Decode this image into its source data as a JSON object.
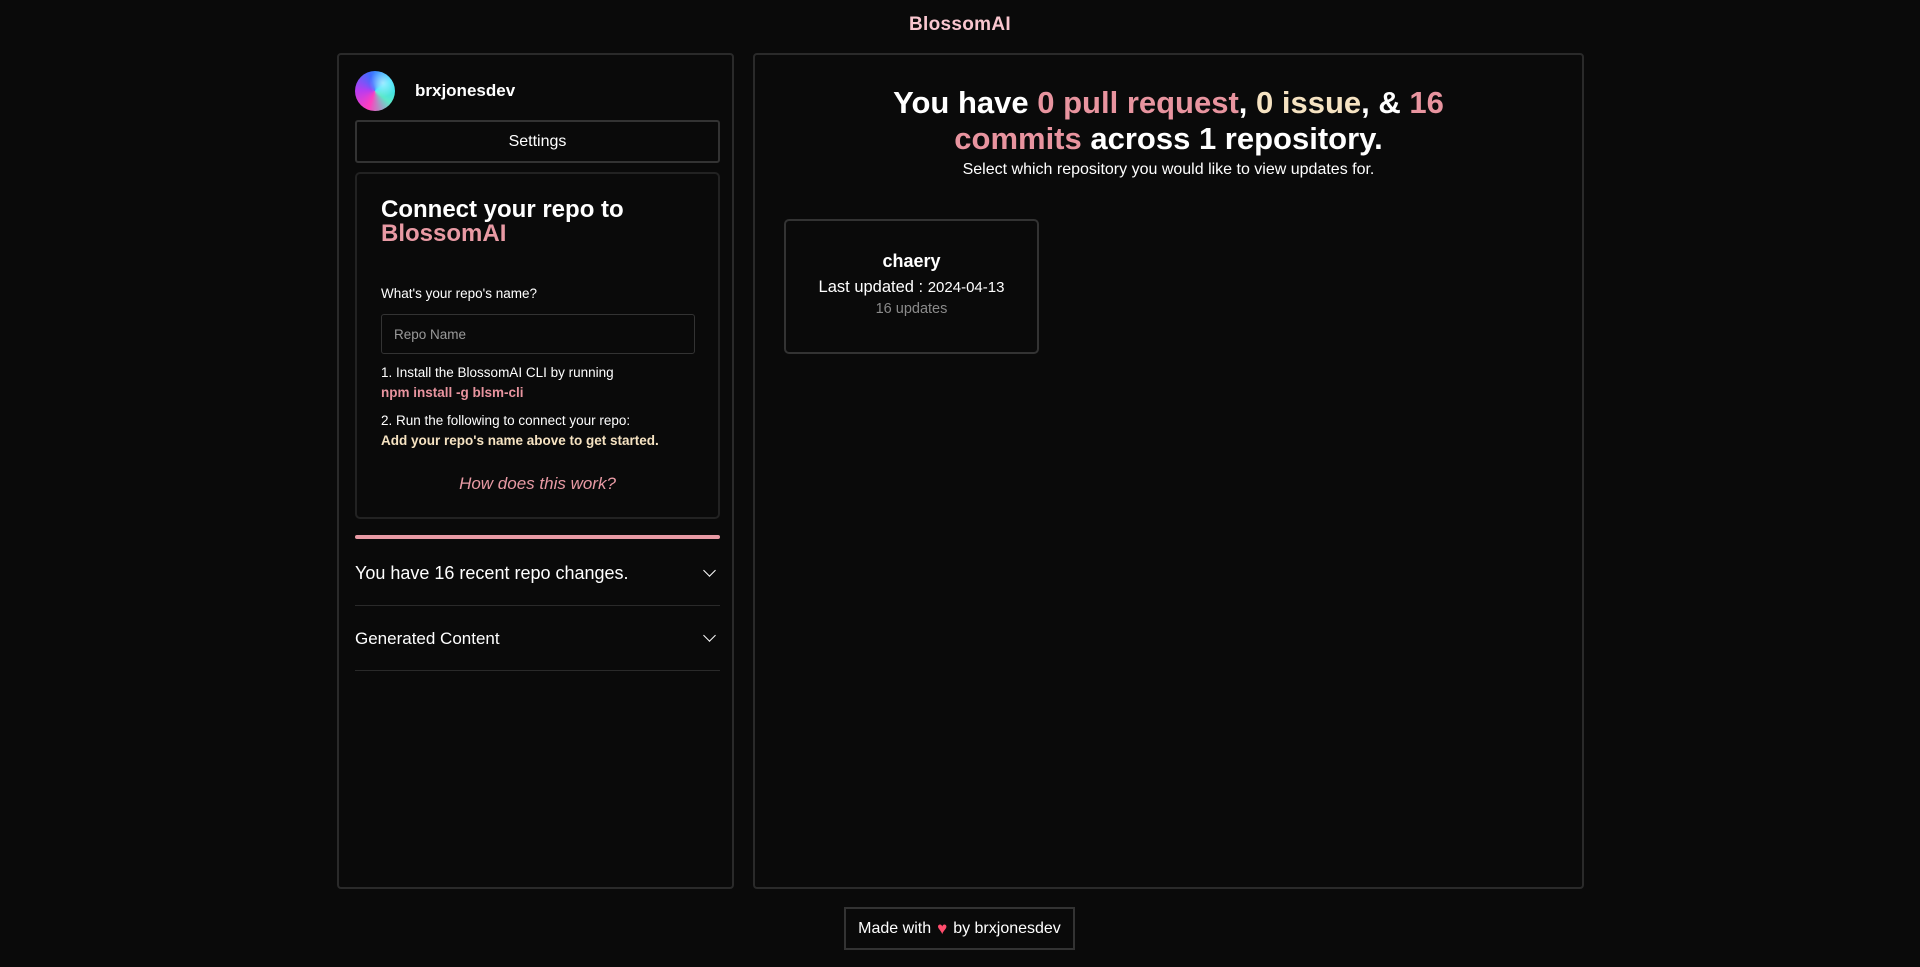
{
  "app": {
    "brand": "BlossomAI"
  },
  "sidebar": {
    "username": "brxjonesdev",
    "settings_label": "Settings",
    "connect": {
      "title_prefix": "Connect your repo to",
      "title_brand": "BlossomAI",
      "repo_label": "What's your repo's name?",
      "repo_placeholder": "Repo Name",
      "repo_value": "",
      "step1": "1. Install the BlossomAI CLI by running",
      "step1_cmd": "npm install -g blsm-cli",
      "step2": "2. Run the following to connect your repo:",
      "step2_hint": "Add your repo's name above to get started.",
      "help_link": "How does this work?"
    },
    "accordions": [
      {
        "label": "You have 16 recent repo changes."
      },
      {
        "label": "Generated Content"
      }
    ]
  },
  "main": {
    "headline": {
      "you_have": "You have",
      "pull_request": "0 pull request",
      "comma1": ",",
      "issue": "0 issue",
      "comma_amp": ", &",
      "commits_num": "16",
      "commits_word": "commits",
      "across": "across 1 repository."
    },
    "subline": "Select which repository you would like to view updates for.",
    "repos": [
      {
        "name": "chaery",
        "updated_label": "Last updated : ",
        "updated_date": "2024-04-13",
        "updates": "16 updates"
      }
    ]
  },
  "footer": {
    "made_with": "Made with",
    "heart": "♥",
    "by": "by brxjonesdev"
  },
  "colors": {
    "background": "#0a0a0a",
    "brand_pink": "#f9c6cf",
    "accent_pink": "#e8949f",
    "accent_cream": "#f6e3c2",
    "heart": "#ff4d6d"
  },
  "icons": {
    "accordion_toggle": "chevron-down-icon",
    "footer_heart": "heart-icon"
  }
}
